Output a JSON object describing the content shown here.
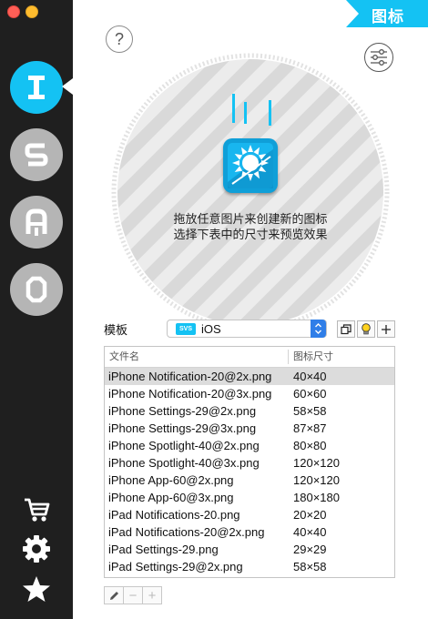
{
  "window": {
    "title_tag": "图标"
  },
  "sidebar": {
    "nav": [
      {
        "letter": "I",
        "active": true
      },
      {
        "letter": "S",
        "active": false
      },
      {
        "letter": "A",
        "active": false
      },
      {
        "letter": "O",
        "active": false
      }
    ],
    "bottom_icons": [
      "cart-icon",
      "gear-icon",
      "star-icon"
    ]
  },
  "dropzone": {
    "help_label": "?",
    "line1": "拖放任意图片来创建新的图标",
    "line2": "选择下表中的尺寸来预览效果"
  },
  "template": {
    "label": "模板",
    "badge": "SVS",
    "value": "iOS"
  },
  "table": {
    "columns": [
      "文件名",
      "图标尺寸"
    ],
    "rows": [
      {
        "name": "iPhone Notification-20@2x.png",
        "size": "40×40",
        "selected": true
      },
      {
        "name": "iPhone Notification-20@3x.png",
        "size": "60×60"
      },
      {
        "name": "iPhone Settings-29@2x.png",
        "size": "58×58"
      },
      {
        "name": "iPhone Settings-29@3x.png",
        "size": "87×87"
      },
      {
        "name": "iPhone Spotlight-40@2x.png",
        "size": "80×80"
      },
      {
        "name": "iPhone Spotlight-40@3x.png",
        "size": "120×120"
      },
      {
        "name": "iPhone App-60@2x.png",
        "size": "120×120"
      },
      {
        "name": "iPhone App-60@3x.png",
        "size": "180×180"
      },
      {
        "name": "iPad Notifications-20.png",
        "size": "20×20"
      },
      {
        "name": "iPad Notifications-20@2x.png",
        "size": "40×40"
      },
      {
        "name": "iPad Settings-29.png",
        "size": "29×29"
      },
      {
        "name": "iPad Settings-29@2x.png",
        "size": "58×58"
      }
    ]
  },
  "edit_buttons": {
    "minus": "−",
    "plus": "+"
  },
  "colors": {
    "accent": "#14c2f3",
    "sidebar": "#1f1f1f",
    "inactive_nav": "#b5b5b5"
  }
}
